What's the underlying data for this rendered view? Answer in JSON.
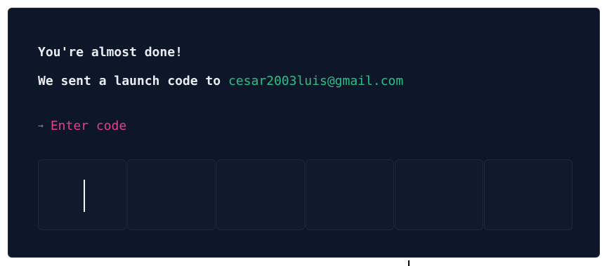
{
  "message": {
    "line1": "You're almost done!",
    "line2_prefix": "We sent a launch code to ",
    "email": "cesar2003luis@gmail.com"
  },
  "prompt": {
    "arrow_icon": "→",
    "label": "Enter code"
  },
  "code_input": {
    "digits": [
      "",
      "",
      "",
      "",
      "",
      ""
    ],
    "active_index": 0
  },
  "colors": {
    "background": "#0e1729",
    "text": "#e9edf2",
    "email": "#2dbf85",
    "prompt": "#e0418f"
  }
}
